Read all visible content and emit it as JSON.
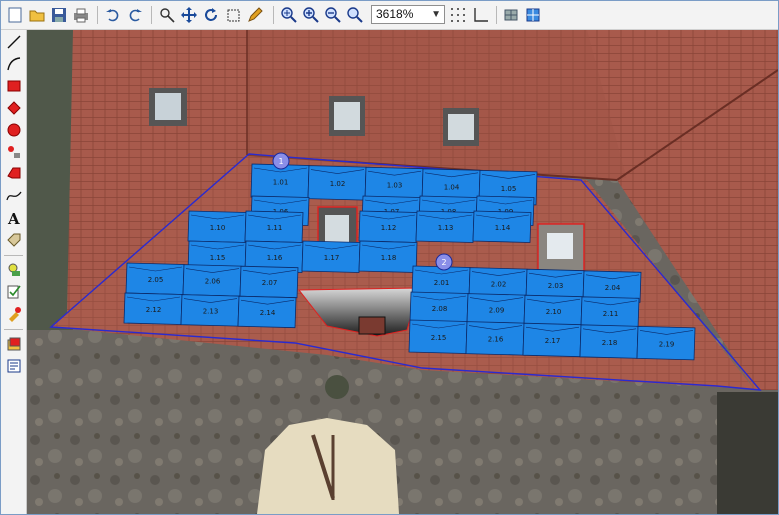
{
  "toolbar": {
    "zoom_value": "3618%",
    "icons": [
      "new-document-icon",
      "open-folder-icon",
      "save-icon",
      "print-icon",
      "undo-icon",
      "redo-icon",
      "select-pan-icon",
      "move-icon",
      "rotate-icon",
      "crop-icon",
      "draw-icon",
      "zoom-in-icon",
      "zoom-plus-icon",
      "zoom-minus-icon",
      "zoom-extent-icon",
      "grid-icon",
      "angle-icon",
      "module-icon",
      "layout-icon"
    ]
  },
  "sidebar": {
    "tools": [
      "line-tool-icon",
      "arc-tool-icon",
      "rectangle-tool-icon",
      "diamond-tool-icon",
      "circle-tool-icon",
      "point-tool-icon",
      "polygon-tool-icon",
      "freehand-tool-icon",
      "text-tool-icon",
      "label-tool-icon",
      "module-place-icon",
      "check-edit-icon",
      "color-pick-icon",
      "layer-icon",
      "report-icon"
    ]
  },
  "markers": [
    {
      "label": "1"
    },
    {
      "label": "2"
    }
  ],
  "panels": {
    "r1": [
      "1.01",
      "1.02",
      "1.03",
      "1.04",
      "1.05"
    ],
    "r2": [
      "1.06",
      "1.07",
      "1.08",
      "1.09"
    ],
    "r3": [
      "1.10",
      "1.11",
      "1.12",
      "1.13",
      "1.14"
    ],
    "r4": [
      "1.15",
      "1.16",
      "1.17",
      "1.18"
    ],
    "r5": [
      "2.01",
      "2.02",
      "2.03",
      "2.04"
    ],
    "r6": [
      "2.05",
      "2.06",
      "2.07"
    ],
    "r7": [
      "2.08",
      "2.09",
      "2.10",
      "2.11"
    ],
    "r8": [
      "2.12",
      "2.13",
      "2.14"
    ],
    "r9": [
      "2.15",
      "2.16",
      "2.17",
      "2.18",
      "2.19"
    ]
  },
  "colors": {
    "panel_fill": "#1e86e6",
    "panel_stroke": "#0a2a6a",
    "roof_outline": "#2a2ad0",
    "obstacle_outline": "#e02020"
  }
}
